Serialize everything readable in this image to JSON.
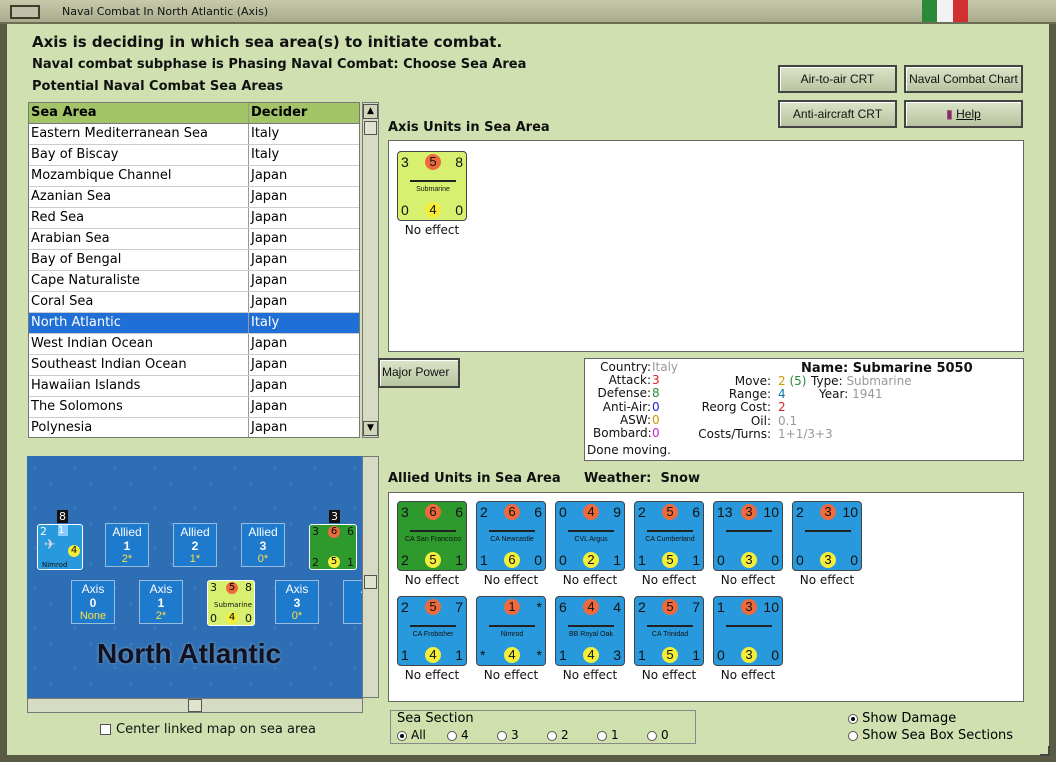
{
  "window": {
    "title": "Naval Combat In North Atlantic (Axis)"
  },
  "header": {
    "line1": "Axis is deciding in which sea area(s) to initiate combat.",
    "line2": "Naval combat subphase is Phasing Naval Combat: Choose Sea Area",
    "line3": "Potential Naval Combat Sea Areas"
  },
  "buttons": {
    "air_to_air": "Air-to-air CRT",
    "naval_chart": "Naval Combat Chart",
    "anti_aircraft": "Anti-aircraft CRT",
    "help": "Help",
    "major_power": "Major Power"
  },
  "sea_table": {
    "headers": [
      "Sea Area",
      "Decider"
    ],
    "rows": [
      [
        "Eastern Mediterranean Sea",
        "Italy"
      ],
      [
        "Bay of Biscay",
        "Italy"
      ],
      [
        "Mozambique Channel",
        "Japan"
      ],
      [
        "Azanian Sea",
        "Japan"
      ],
      [
        "Red Sea",
        "Japan"
      ],
      [
        "Arabian Sea",
        "Japan"
      ],
      [
        "Bay of Bengal",
        "Japan"
      ],
      [
        "Cape Naturaliste",
        "Japan"
      ],
      [
        "Coral Sea",
        "Japan"
      ],
      [
        "North Atlantic",
        "Italy"
      ],
      [
        "West Indian Ocean",
        "Japan"
      ],
      [
        "Southeast Indian Ocean",
        "Japan"
      ],
      [
        "Hawaiian Islands",
        "Japan"
      ],
      [
        "The Solomons",
        "Japan"
      ],
      [
        "Polynesia",
        "Japan"
      ]
    ],
    "selected_index": 9
  },
  "map": {
    "title": "North Atlantic",
    "allied_boxes": [
      {
        "label": "Allied",
        "num": "1",
        "sub": "2*"
      },
      {
        "label": "Allied",
        "num": "2",
        "sub": "1*"
      },
      {
        "label": "Allied",
        "num": "3",
        "sub": "0*"
      }
    ],
    "axis_boxes": [
      {
        "label": "Axis",
        "num": "0",
        "sub": "None"
      },
      {
        "label": "Axis",
        "num": "1",
        "sub": "2*"
      },
      {
        "label": "Axis",
        "num": "3",
        "sub": "0*"
      },
      {
        "label": "A",
        "num": "",
        "sub": ""
      }
    ],
    "stack_counts": [
      "8",
      "3"
    ],
    "center_linked_label": "Center linked map on sea area"
  },
  "axis_units": {
    "title": "Axis Units in Sea Area",
    "units": [
      {
        "name": "Submarine",
        "tl": "3",
        "tc": "5",
        "tr": "8",
        "bl": "0",
        "bc": "4",
        "br": "0",
        "effect": "No effect",
        "color": "yellow"
      }
    ]
  },
  "unit_info": {
    "country_label": "Country:",
    "country": "Italy",
    "attack_label": "Attack:",
    "attack": "3",
    "defense_label": "Defense:",
    "defense": "8",
    "antiair_label": "Anti-Air:",
    "antiair": "0",
    "asw_label": "ASW:",
    "asw": "0",
    "bombard_label": "Bombard:",
    "bombard": "0",
    "status": "Done moving.",
    "name_label": "Name:",
    "name": "Submarine 5050",
    "move_label": "Move:",
    "move": "2",
    "move_paren": "(5)",
    "range_label": "Range:",
    "range": "4",
    "reorg_label": "Reorg Cost:",
    "reorg": "2",
    "oil_label": "Oil:",
    "oil": "0.1",
    "costs_label": "Costs/Turns:",
    "costs": "1+1/3+3",
    "type_label": "Type:",
    "type": "Submarine",
    "year_label": "Year:",
    "year": "1941"
  },
  "allied_units": {
    "title": "Allied Units in Sea Area",
    "weather_label": "Weather:",
    "weather": "Snow",
    "units": [
      {
        "name": "CA San Francisco",
        "tl": "3",
        "tc": "6",
        "tr": "6",
        "bl": "2",
        "bc": "5",
        "br": "1",
        "effect": "No effect",
        "color": "green"
      },
      {
        "name": "CA Newcastle",
        "tl": "2",
        "tc": "6",
        "tr": "6",
        "bl": "1",
        "bc": "6",
        "br": "0",
        "effect": "No effect",
        "color": "blue"
      },
      {
        "name": "CVL Argus",
        "tl": "0",
        "tc": "4",
        "tr": "9",
        "bl": "0",
        "bc": "2",
        "br": "1",
        "effect": "No effect",
        "color": "blue"
      },
      {
        "name": "CA Cumberland",
        "tl": "2",
        "tc": "5",
        "tr": "6",
        "bl": "1",
        "bc": "5",
        "br": "1",
        "effect": "No effect",
        "color": "blue"
      },
      {
        "name": "",
        "tl": "13",
        "tc": "3",
        "tr": "10",
        "bl": "0",
        "bc": "3",
        "br": "0",
        "effect": "No effect",
        "color": "blue"
      },
      {
        "name": "",
        "tl": "2",
        "tc": "3",
        "tr": "10",
        "bl": "0",
        "bc": "3",
        "br": "0",
        "effect": "No effect",
        "color": "blue"
      },
      {
        "name": "CA Frobisher",
        "tl": "2",
        "tc": "5",
        "tr": "7",
        "bl": "1",
        "bc": "4",
        "br": "1",
        "effect": "No effect",
        "color": "blue"
      },
      {
        "name": "Nimrod",
        "tl": "",
        "tc": "1",
        "tr": "*",
        "bl": "*",
        "bc": "4",
        "br": "*",
        "effect": "No effect",
        "color": "blue"
      },
      {
        "name": "BB Royal Oak",
        "tl": "6",
        "tc": "4",
        "tr": "4",
        "bl": "1",
        "bc": "4",
        "br": "3",
        "effect": "No effect",
        "color": "blue"
      },
      {
        "name": "CA Trinidad",
        "tl": "2",
        "tc": "5",
        "tr": "7",
        "bl": "1",
        "bc": "5",
        "br": "1",
        "effect": "No effect",
        "color": "blue"
      },
      {
        "name": "",
        "tl": "1",
        "tc": "3",
        "tr": "10",
        "bl": "0",
        "bc": "3",
        "br": "0",
        "effect": "No effect",
        "color": "blue"
      }
    ]
  },
  "sea_section": {
    "title": "Sea Section",
    "options": [
      "All",
      "4",
      "3",
      "2",
      "1",
      "0"
    ],
    "selected": "All"
  },
  "display_options": {
    "show_damage": "Show Damage",
    "show_sections": "Show Sea Box Sections"
  },
  "colors": {
    "accent": "#1f6fd6",
    "header_green": "#a4c468",
    "counter_blue": "#2899dc"
  }
}
